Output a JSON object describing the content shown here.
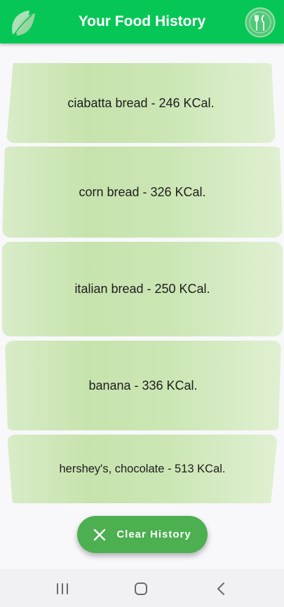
{
  "app_bar": {
    "title": "Your Food History",
    "logo_icon": "leaf-icon",
    "menu_icon": "fork-knife-icon",
    "color": "#06c755"
  },
  "history": [
    {
      "label": "ciabatta bread - 246 KCal."
    },
    {
      "label": "corn bread - 326 KCal."
    },
    {
      "label": "italian bread - 250 KCal."
    },
    {
      "label": "banana - 336 KCal."
    },
    {
      "label": "hershey's, chocolate - 513 KCal."
    }
  ],
  "fab": {
    "label": "Clear History",
    "icon": "close-icon",
    "color": "#4caf50"
  },
  "system_nav": {
    "recents_icon": "recents-icon",
    "home_icon": "home-icon",
    "back_icon": "back-icon"
  }
}
